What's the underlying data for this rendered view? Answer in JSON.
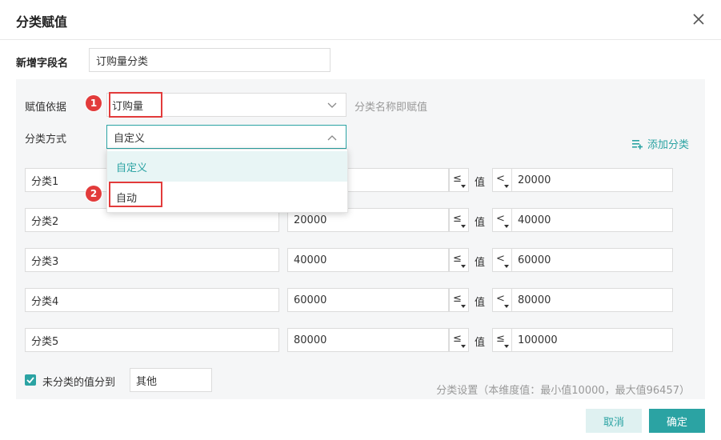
{
  "dialog": {
    "title": "分类赋值"
  },
  "field": {
    "label": "新增字段名",
    "value": "订购量分类"
  },
  "basis": {
    "label": "赋值依据",
    "value": "订购量",
    "hint": "分类名称即赋值"
  },
  "method": {
    "label": "分类方式",
    "value": "自定义",
    "options": [
      "自定义",
      "自动"
    ]
  },
  "add_category_label": "添加分类",
  "value_label": "值",
  "rows": [
    {
      "name": "分类1",
      "min": "",
      "min_op": "≤",
      "max_op": "<",
      "max": "20000"
    },
    {
      "name": "分类2",
      "min": "20000",
      "min_op": "≤",
      "max_op": "<",
      "max": "40000"
    },
    {
      "name": "分类3",
      "min": "40000",
      "min_op": "≤",
      "max_op": "<",
      "max": "60000"
    },
    {
      "name": "分类4",
      "min": "60000",
      "min_op": "≤",
      "max_op": "<",
      "max": "80000"
    },
    {
      "name": "分类5",
      "min": "80000",
      "min_op": "≤",
      "max_op": "≤",
      "max": "100000"
    }
  ],
  "unclassified": {
    "label": "未分类的值分到",
    "value": "其他",
    "checked": true
  },
  "footnote": "分类设置（本维度值：最小值10000，最大值96457）",
  "markers": [
    "1",
    "2"
  ],
  "buttons": {
    "cancel": "取消",
    "ok": "确定"
  },
  "colors": {
    "accent": "#2ba3a3",
    "marker": "#e23b3b"
  }
}
